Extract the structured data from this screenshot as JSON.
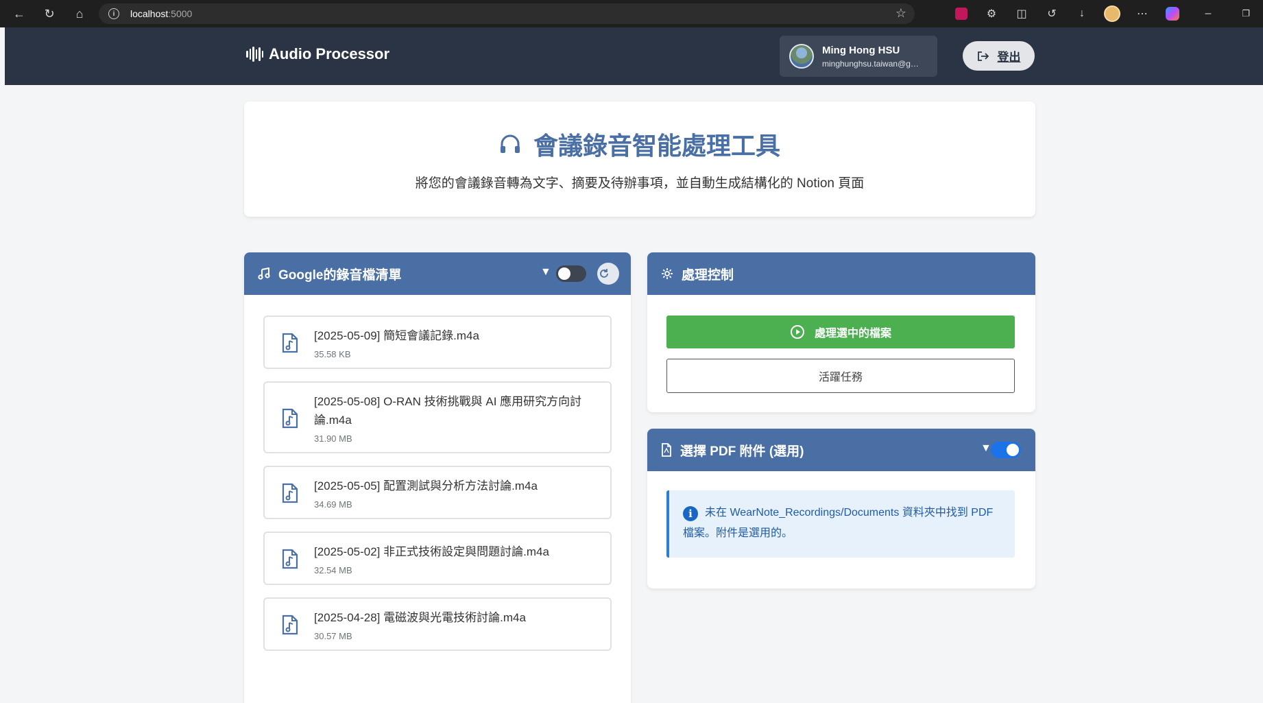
{
  "browser": {
    "url_host": "localhost",
    "url_port": ":5000"
  },
  "navbar": {
    "brand": "Audio Processor",
    "user_name": "Ming Hong HSU",
    "user_email": "minghunghsu.taiwan@gmail.com",
    "logout_label": "登出"
  },
  "hero": {
    "title": "會議錄音智能處理工具",
    "subtitle": "將您的會議錄音轉為文字、摘要及待辦事項，並自動生成結構化的 Notion 頁面"
  },
  "recordings": {
    "title": "Google的錄音檔清單",
    "filter_enabled": false,
    "files": [
      {
        "name": "[2025-05-09] 簡短會議記錄.m4a",
        "size": "35.58 KB"
      },
      {
        "name": "[2025-05-08] O-RAN 技術挑戰與 AI 應用研究方向討論.m4a",
        "size": "31.90 MB"
      },
      {
        "name": "[2025-05-05] 配置測試與分析方法討論.m4a",
        "size": "34.69 MB"
      },
      {
        "name": "[2025-05-02] 非正式技術設定與問題討論.m4a",
        "size": "32.54 MB"
      },
      {
        "name": "[2025-04-28] 電磁波與光電技術討論.m4a",
        "size": "30.57 MB"
      }
    ]
  },
  "control": {
    "title": "處理控制",
    "process_label": "處理選中的檔案",
    "active_tasks_label": "活躍任務"
  },
  "pdf": {
    "title": "選擇 PDF 附件 (選用)",
    "filter_enabled": true,
    "alert_text": "未在 WearNote_Recordings/Documents 資料夾中找到 PDF 檔案。附件是選用的。"
  },
  "colors": {
    "navbar": "#2b3444",
    "primary": "#4a6fa5",
    "success": "#4caf50",
    "toggle_on": "#1a73e8",
    "toggle_off": "#3e4450"
  }
}
